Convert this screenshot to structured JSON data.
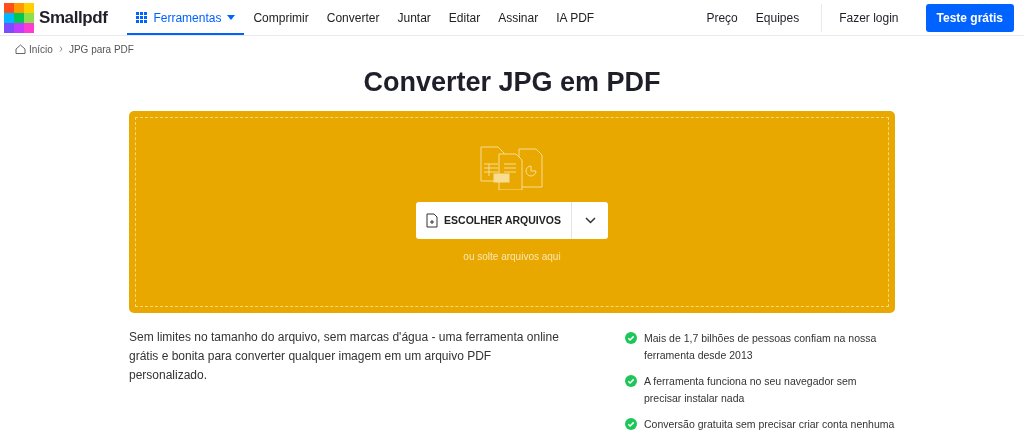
{
  "logo": {
    "text": "Smallpdf"
  },
  "nav": [
    {
      "label": "Ferramentas",
      "selected": true,
      "kind": "menu"
    },
    {
      "label": "Comprimir",
      "selected": false,
      "kind": "link"
    },
    {
      "label": "Converter",
      "selected": false,
      "kind": "link"
    },
    {
      "label": "Juntar",
      "selected": false,
      "kind": "link"
    },
    {
      "label": "Editar",
      "selected": false,
      "kind": "link"
    },
    {
      "label": "Assinar",
      "selected": false,
      "kind": "link"
    },
    {
      "label": "IA PDF",
      "selected": false,
      "kind": "link"
    }
  ],
  "nav_right": [
    "Preço",
    "Equipes"
  ],
  "login": "Fazer login",
  "cta": "Teste grátis",
  "breadcrumb": [
    "Início",
    "JPG para PDF"
  ],
  "title": "Converter JPG em PDF",
  "dropzone": {
    "button": "ESCOLHER ARQUIVOS",
    "hint": "ou solte arquivos aqui"
  },
  "description": "Sem limites no tamanho do arquivo, sem marcas d'água - uma ferramenta online grátis e bonita para converter qualquer imagem em um arquivo PDF personalizado.",
  "features": [
    "Mais de 1,7 bilhões de pessoas confiam na nossa ferramenta desde 2013",
    "A ferramenta funciona no seu navegador sem precisar instalar nada",
    "Conversão gratuita sem precisar criar conta nenhuma"
  ]
}
